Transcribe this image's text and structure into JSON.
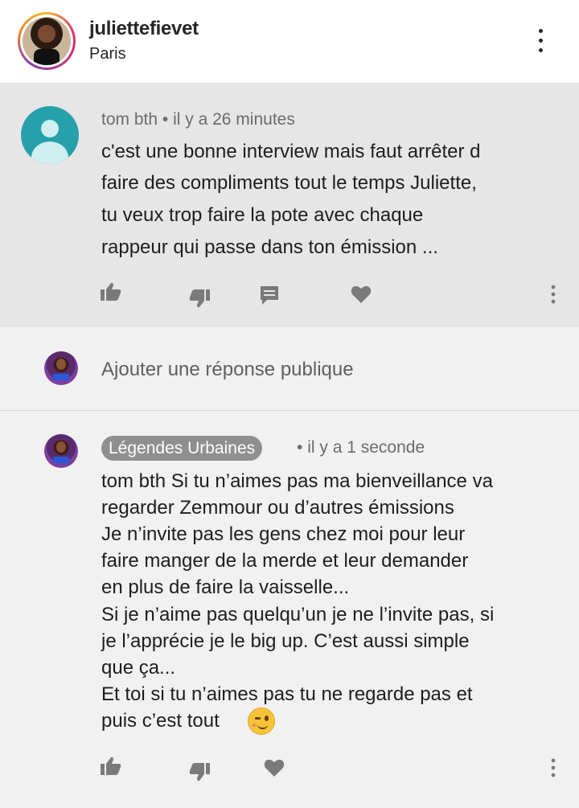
{
  "header": {
    "username": "juliettefievet",
    "location": "Paris",
    "more_icon": "vertical-ellipsis-icon"
  },
  "comment1": {
    "author": "tom bth",
    "separator": "•",
    "time": "il y a 26 minutes",
    "lines": [
      "c'est une bonne interview mais faut arrêter d",
      "faire des compliments tout le temps Juliette,",
      "tu veux trop faire la pote avec chaque",
      "rappeur qui passe dans ton émission ..."
    ],
    "actions": [
      "thumbs-up-icon",
      "thumbs-down-icon",
      "reply-icon",
      "heart-icon",
      "vertical-ellipsis-icon"
    ],
    "background": "#e6e6e6",
    "avatar_color": "#26a0aa"
  },
  "reply_box": {
    "placeholder": "Ajouter une réponse publique"
  },
  "comment2": {
    "author": "Légendes Urbaines",
    "separator": "•",
    "time": "il y a 1 seconde",
    "lines": [
      "tom bth Si tu n’aimes pas ma bienveillance va",
      "regarder Zemmour ou d’autres émissions",
      "Je n’invite pas les gens chez moi pour leur",
      "faire manger de la merde et leur demander",
      "en plus de faire la vaisselle...",
      "Si je n’aime pas quelqu’un je ne l’invite pas, si",
      "je l’apprécie je le big up. C’est aussi simple",
      "que ça...",
      "Et toi si tu n’aimes pas tu ne regarde pas et",
      "puis c’est tout"
    ],
    "emoji": "winking-face-emoji",
    "actions": [
      "thumbs-up-icon",
      "thumbs-down-icon",
      "heart-icon",
      "vertical-ellipsis-icon"
    ],
    "chip_color": "#8f8f8f"
  }
}
